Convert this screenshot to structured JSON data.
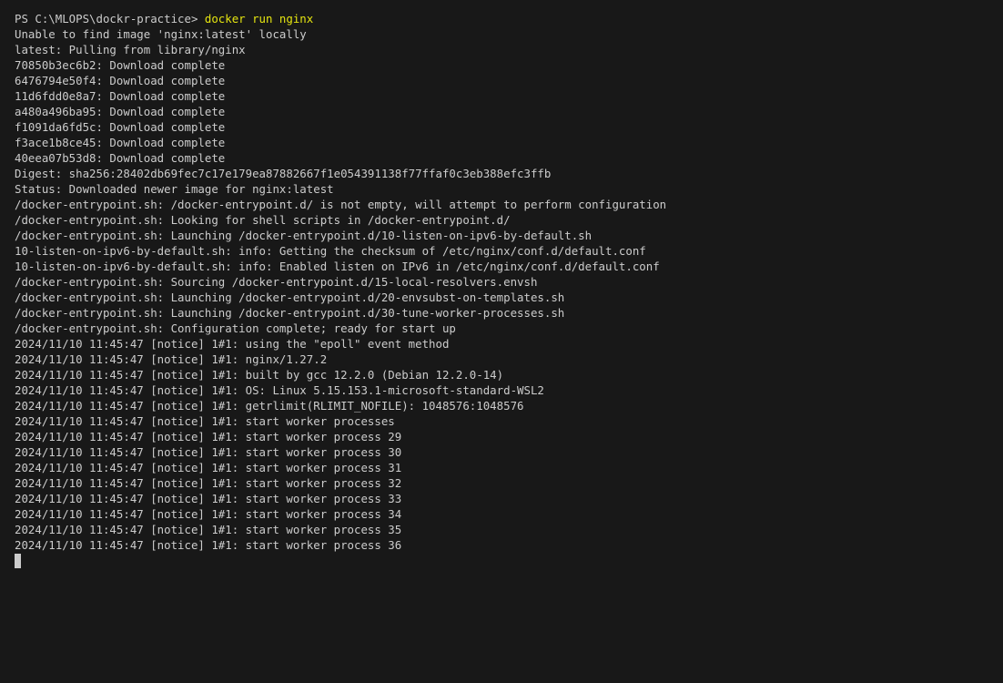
{
  "terminal": {
    "prompt": "PS C:\\MLOPS\\dockr-practice> ",
    "command": "docker run nginx",
    "output": [
      "Unable to find image 'nginx:latest' locally",
      "latest: Pulling from library/nginx",
      "70850b3ec6b2: Download complete",
      "6476794e50f4: Download complete",
      "11d6fdd0e8a7: Download complete",
      "a480a496ba95: Download complete",
      "f1091da6fd5c: Download complete",
      "f3ace1b8ce45: Download complete",
      "40eea07b53d8: Download complete",
      "Digest: sha256:28402db69fec7c17e179ea87882667f1e054391138f77ffaf0c3eb388efc3ffb",
      "Status: Downloaded newer image for nginx:latest",
      "/docker-entrypoint.sh: /docker-entrypoint.d/ is not empty, will attempt to perform configuration",
      "/docker-entrypoint.sh: Looking for shell scripts in /docker-entrypoint.d/",
      "/docker-entrypoint.sh: Launching /docker-entrypoint.d/10-listen-on-ipv6-by-default.sh",
      "10-listen-on-ipv6-by-default.sh: info: Getting the checksum of /etc/nginx/conf.d/default.conf",
      "10-listen-on-ipv6-by-default.sh: info: Enabled listen on IPv6 in /etc/nginx/conf.d/default.conf",
      "/docker-entrypoint.sh: Sourcing /docker-entrypoint.d/15-local-resolvers.envsh",
      "/docker-entrypoint.sh: Launching /docker-entrypoint.d/20-envsubst-on-templates.sh",
      "/docker-entrypoint.sh: Launching /docker-entrypoint.d/30-tune-worker-processes.sh",
      "/docker-entrypoint.sh: Configuration complete; ready for start up",
      "2024/11/10 11:45:47 [notice] 1#1: using the \"epoll\" event method",
      "2024/11/10 11:45:47 [notice] 1#1: nginx/1.27.2",
      "2024/11/10 11:45:47 [notice] 1#1: built by gcc 12.2.0 (Debian 12.2.0-14)",
      "2024/11/10 11:45:47 [notice] 1#1: OS: Linux 5.15.153.1-microsoft-standard-WSL2",
      "2024/11/10 11:45:47 [notice] 1#1: getrlimit(RLIMIT_NOFILE): 1048576:1048576",
      "2024/11/10 11:45:47 [notice] 1#1: start worker processes",
      "2024/11/10 11:45:47 [notice] 1#1: start worker process 29",
      "2024/11/10 11:45:47 [notice] 1#1: start worker process 30",
      "2024/11/10 11:45:47 [notice] 1#1: start worker process 31",
      "2024/11/10 11:45:47 [notice] 1#1: start worker process 32",
      "2024/11/10 11:45:47 [notice] 1#1: start worker process 33",
      "2024/11/10 11:45:47 [notice] 1#1: start worker process 34",
      "2024/11/10 11:45:47 [notice] 1#1: start worker process 35",
      "2024/11/10 11:45:47 [notice] 1#1: start worker process 36"
    ]
  },
  "colors": {
    "background": "#181818",
    "text": "#cccccc",
    "command": "#e5e510"
  }
}
